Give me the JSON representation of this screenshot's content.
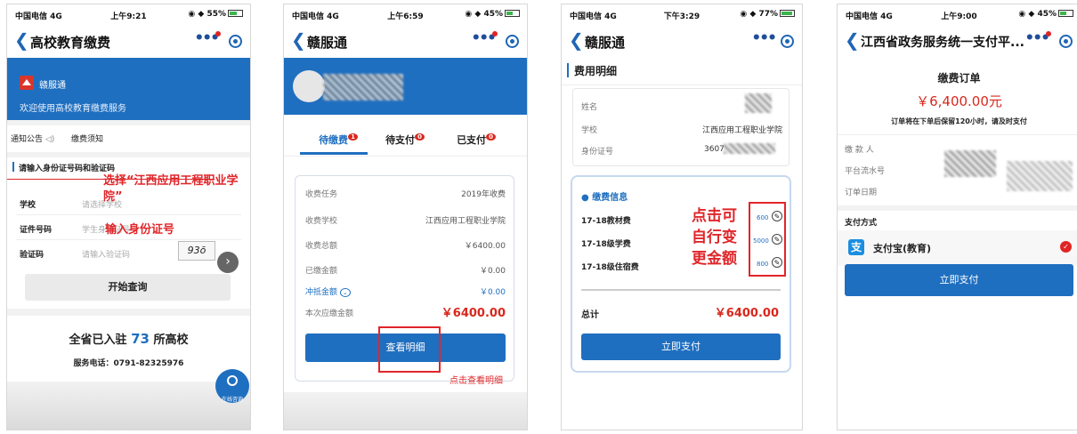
{
  "screens": [
    {
      "status": {
        "carrier": "中国电信  4G",
        "time": "上午9:21",
        "battery": "55%"
      },
      "nav_title": "高校教育缴费",
      "banner": {
        "app_name": "赣服通",
        "welcome": "欢迎使用高校教育缴费服务"
      },
      "notice_tabs": [
        "通知公告",
        "缴费须知"
      ],
      "form_title": "请输入身份证号码和验证码",
      "fields": [
        {
          "label": "学校",
          "placeholder": "请选择学校"
        },
        {
          "label": "证件号码",
          "placeholder": "学生身份证号"
        },
        {
          "label": "验证码",
          "placeholder": "请输入验证码",
          "captcha": "93ō"
        }
      ],
      "annotations": {
        "select_school": "选择“江西应用工程职业学院”",
        "enter_id": "输入身份证号"
      },
      "query_button": "开始查询",
      "stat": {
        "prefix": "全省已入驻",
        "count": "73",
        "suffix": "所高校"
      },
      "phone": "服务电话：0791-82325976",
      "online_service": "在线咨询"
    },
    {
      "status": {
        "carrier": "中国电信  4G",
        "time": "上午6:59",
        "battery": "45%"
      },
      "nav_title": "赣服通",
      "tabs": [
        {
          "label": "待缴费",
          "badge": "1",
          "active": true
        },
        {
          "label": "待支付",
          "badge": "0",
          "active": false
        },
        {
          "label": "已支付",
          "badge": "0",
          "active": false
        }
      ],
      "rows": [
        {
          "label": "收费任务",
          "value": "2019年收费"
        },
        {
          "label": "收费学校",
          "value": "江西应用工程职业学院"
        },
        {
          "label": "收费总额",
          "value": "￥6400.00"
        },
        {
          "label": "已缴金额",
          "value": "￥0.00"
        },
        {
          "label": "冲抵金额",
          "value": "￥0.00"
        },
        {
          "label": "本次应缴金额",
          "value": "￥6400.00"
        }
      ],
      "detail_button": "查看明细",
      "annotation": "点击查看明细"
    },
    {
      "status": {
        "carrier": "中国电信  4G",
        "time": "下午3:29",
        "battery": "77%"
      },
      "nav_title": "赣服通",
      "section_title": "费用明细",
      "info_rows": [
        {
          "label": "姓名",
          "value": ""
        },
        {
          "label": "学校",
          "value": "江西应用工程职业学院"
        },
        {
          "label": "身份证号",
          "value": "3607"
        }
      ],
      "fee_title": "缴费信息",
      "fees": [
        {
          "label": "17-18教材费",
          "value": "600"
        },
        {
          "label": "17-18级学费",
          "value": "5000"
        },
        {
          "label": "17-18级住宿费",
          "value": "800"
        }
      ],
      "annotation": [
        "点击可",
        "自行变",
        "更金额"
      ],
      "total_label": "总计",
      "total_value": "￥6400.00",
      "pay_button": "立即支付"
    },
    {
      "status": {
        "carrier": "中国电信  4G",
        "time": "上午9:00",
        "battery": "45%"
      },
      "nav_title": "江西省政务服务统一支付平...",
      "order_title": "缴费订单",
      "amount": "￥6,400.00元",
      "hint": "订单将在下单后保留120小时，请及时支付",
      "info_labels": [
        "缴 款 人",
        "平台流水号",
        "订单日期"
      ],
      "pay_method_title": "支付方式",
      "pay_method": "支付宝(教育)",
      "pay_button": "立即支付"
    }
  ]
}
